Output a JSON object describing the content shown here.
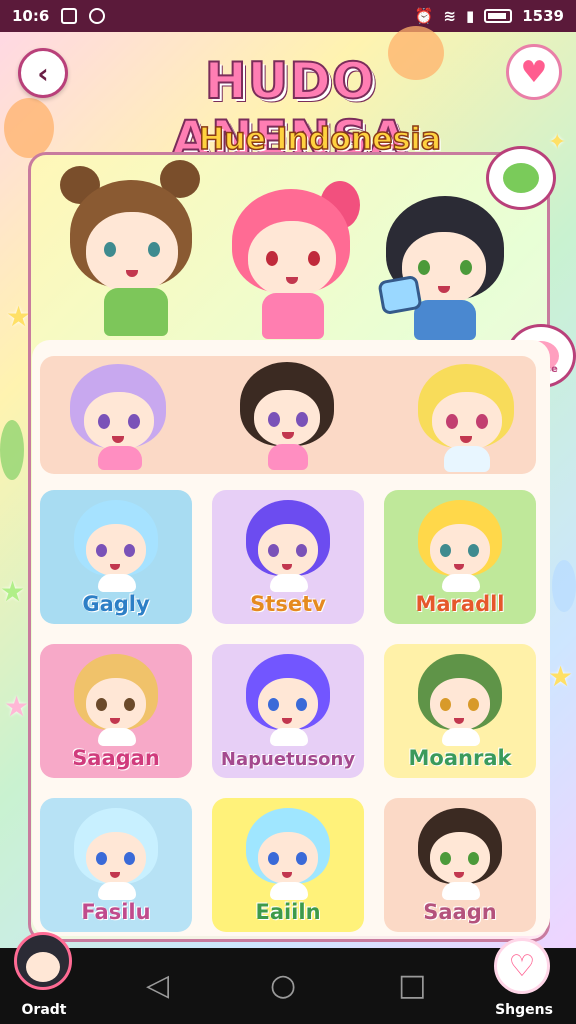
{
  "status_bar": {
    "time": "10:6",
    "battery": "1539"
  },
  "header": {
    "title": "HUDO ANENSA",
    "subtitle": "Hue Indonesia"
  },
  "bubbles": {
    "right_small_text": "Soase"
  },
  "cards": [
    {
      "label": "Gagly",
      "bg": "#a8dcf2",
      "label_color": "#2d7fc6"
    },
    {
      "label": "Stsetv",
      "bg": "#e7cff6",
      "label_color": "#e58a20"
    },
    {
      "label": "Maradll",
      "bg": "#bfe89a",
      "label_color": "#e5582b"
    },
    {
      "label": "Saagan",
      "bg": "#f7a9c8",
      "label_color": "#d03b7c"
    },
    {
      "label": "Napuetusony",
      "bg": "#e7cff6",
      "label_color": "#a44a8e"
    },
    {
      "label": "Moanrak",
      "bg": "#fff1a8",
      "label_color": "#3a9a5b"
    },
    {
      "label": "Fasilu",
      "bg": "#b7e2f5",
      "label_color": "#c04b8d"
    },
    {
      "label": "Eaiiln",
      "bg": "#fff27a",
      "label_color": "#3d9a4a"
    },
    {
      "label": "Saagn",
      "bg": "#fbd9c6",
      "label_color": "#b4527c"
    }
  ],
  "bottom": {
    "profile_label": "Oradt",
    "favorites_label": "Shgens"
  },
  "colors": {
    "accent": "#ff7eb3",
    "outline": "#7a2d5a",
    "nav": "#111111"
  },
  "icons": [
    "back-arrow-icon",
    "heart-icon",
    "back-triangle-icon",
    "home-circle-icon",
    "recents-square-icon"
  ]
}
